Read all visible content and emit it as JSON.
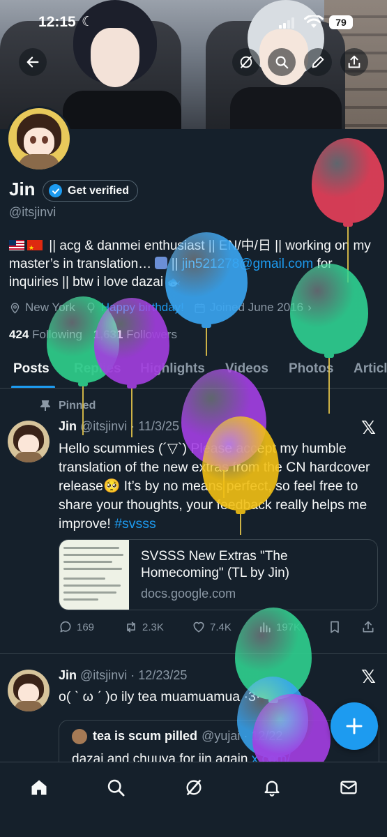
{
  "status_bar": {
    "time": "12:15",
    "battery": "79"
  },
  "profile": {
    "name": "Jin",
    "verify_label": "Get verified",
    "handle": "@itsjinvi",
    "bio_parts": {
      "text1": " || acg & danmei enthusiast || EN/中/日 || working on my master’s in translation…",
      "text2": " || ",
      "email": "jin521278@gmail.com",
      "text3": " for inquiries || btw i love dazai "
    },
    "location": "New York",
    "birthday": "Happy birthday!",
    "joined": "Joined June 2016",
    "following_count": "424",
    "following_label": "Following",
    "followers_count": "1,631",
    "followers_label": "Followers"
  },
  "tabs": [
    "Posts",
    "Replies",
    "Highlights",
    "Videos",
    "Photos",
    "Articles"
  ],
  "post1": {
    "pinned_label": "Pinned",
    "author": "Jin",
    "meta": "@itsjinvi · 11/3/25",
    "text": "Hello scummies (´▽`) Please accept my humble translation of the new extras from the CN hardcover release🥺 It’s by no means perfect, so feel free to share your thoughts, your feedback really helps me improve! ",
    "hashtag": "#svsss",
    "card_title": "SVSSS New Extras \"The Homecoming\" (TL by Jin)",
    "card_domain": "docs.google.com",
    "replies": "169",
    "reposts": "2.3K",
    "likes": "7.4K",
    "views": "197K"
  },
  "post2": {
    "author": "Jin",
    "meta": "@itsjinvi · 12/23/25",
    "text": "o( ˋ ω ˊ )o ily tea muamuamua ·3·",
    "quote_name": "tea is scum pilled",
    "quote_handle": "@yujai · 12/22",
    "quote_text": "dazai and chuuya for jin again ",
    "quote_link": "x.com/..."
  },
  "colors": {
    "background": "#15202b",
    "accent": "#1d9bf0",
    "muted": "#8b98a5",
    "border": "#38444d"
  }
}
